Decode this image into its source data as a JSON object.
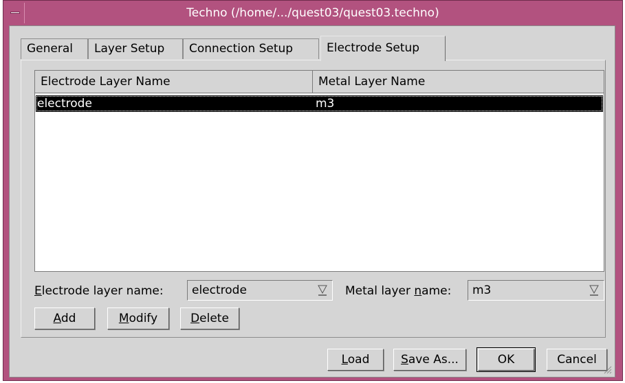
{
  "window": {
    "title": "Techno (/home/.../quest03/quest03.techno)",
    "accent": "#b2527f"
  },
  "tabs": [
    {
      "label": "General",
      "active": false
    },
    {
      "label": "Layer Setup",
      "active": false
    },
    {
      "label": "Connection Setup",
      "active": false
    },
    {
      "label": "Electrode Setup",
      "active": true
    }
  ],
  "table": {
    "columns": [
      "Electrode Layer Name",
      "Metal Layer Name"
    ],
    "rows": [
      {
        "electrode": "electrode",
        "metal": "m3",
        "selected": true
      }
    ]
  },
  "form": {
    "electrode_label_mn": "E",
    "electrode_label_rest": "lectrode layer name:",
    "electrode_value": "electrode",
    "metal_label_pre": "Metal layer ",
    "metal_label_mn": "n",
    "metal_label_rest": "ame:",
    "metal_value": "m3"
  },
  "actions": {
    "add_mn": "A",
    "add_rest": "dd",
    "modify_mn": "M",
    "modify_rest": "odify",
    "delete_mn": "D",
    "delete_rest": "elete"
  },
  "footer": {
    "load_mn": "L",
    "load_rest": "oad",
    "save_as_mn": "S",
    "save_as_rest": "ave As...",
    "ok": "OK",
    "cancel": "Cancel"
  }
}
